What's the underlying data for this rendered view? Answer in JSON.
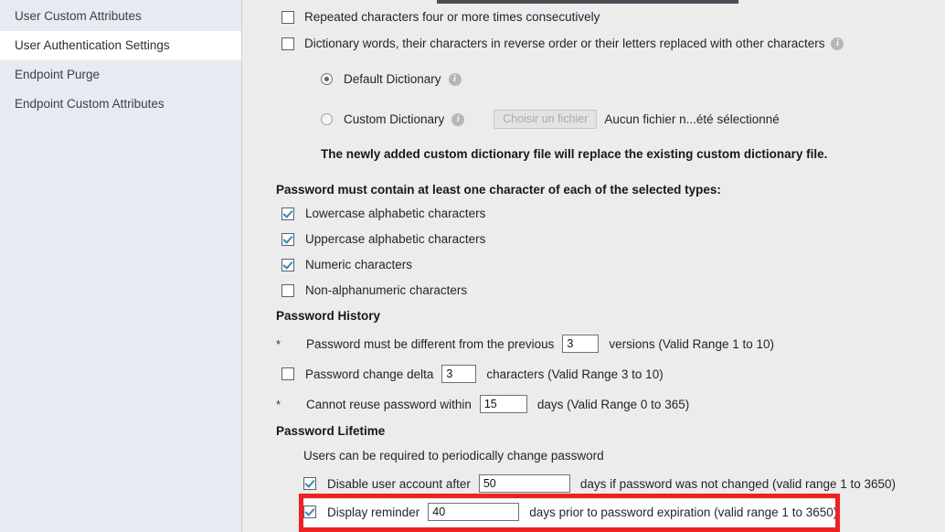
{
  "sidebar": {
    "items": [
      {
        "label": "User Custom Attributes",
        "selected": false
      },
      {
        "label": "User Authentication Settings",
        "selected": true
      },
      {
        "label": "Endpoint Purge",
        "selected": false
      },
      {
        "label": "Endpoint Custom Attributes",
        "selected": false
      }
    ]
  },
  "password_complexity": {
    "repeated_chars": {
      "label": "Repeated characters four or more times consecutively",
      "checked": false
    },
    "dictionary_words": {
      "label": "Dictionary words, their characters in reverse order or their letters replaced with other characters",
      "checked": false,
      "info_icon": "info-icon"
    },
    "default_dictionary": {
      "label": "Default Dictionary",
      "selected": true,
      "info_icon": "info-icon"
    },
    "custom_dictionary": {
      "label": "Custom Dictionary",
      "selected": false,
      "info_icon": "info-icon"
    },
    "file_chooser": {
      "button_label": "Choisir un fichier",
      "file_status": "Aucun fichier n...été sélectionné",
      "disabled": true
    },
    "replace_notice": "The newly added custom dictionary file will replace the existing custom dictionary file."
  },
  "char_types": {
    "heading": "Password must contain at least one character of each of the selected types:",
    "options": [
      {
        "label": "Lowercase alphabetic characters",
        "checked": true
      },
      {
        "label": "Uppercase alphabetic characters",
        "checked": true
      },
      {
        "label": "Numeric characters",
        "checked": true
      },
      {
        "label": "Non-alphanumeric characters",
        "checked": false
      }
    ]
  },
  "password_history": {
    "heading": "Password History",
    "different_from_previous": {
      "marker": "*",
      "label_before": "Password must be different from the previous",
      "value": "3",
      "label_after": "versions (Valid Range 1 to 10)"
    },
    "change_delta": {
      "checked": false,
      "label_before": "Password change delta",
      "value": "3",
      "label_after": "characters   (Valid Range 3 to 10)"
    },
    "cannot_reuse": {
      "marker": "*",
      "label_before": "Cannot reuse password within",
      "value": "15",
      "label_after": "days (Valid Range 0 to 365)"
    }
  },
  "password_lifetime": {
    "heading": "Password Lifetime",
    "subtitle": "Users can be required to periodically change password",
    "disable_account": {
      "checked": true,
      "label_before": "Disable user account after",
      "value": "50",
      "label_after": "days if password was not changed (valid range 1 to 3650)"
    },
    "display_reminder": {
      "checked": true,
      "label_before": "Display reminder",
      "value": "40",
      "label_after": "days prior to password expiration (valid range 1 to 3650)",
      "highlighted": true
    }
  },
  "colors": {
    "sidebar_bg": "#e7eaf0",
    "content_bg": "#ececec",
    "selected_row_bg": "#ffffff",
    "checkbox_check": "#3b8ab0",
    "highlight_border": "#ee2222"
  }
}
